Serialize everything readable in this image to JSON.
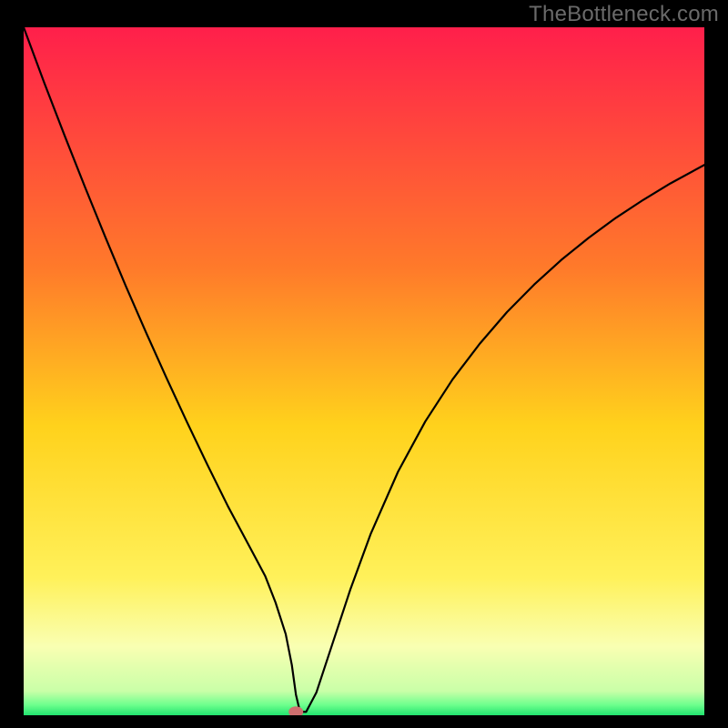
{
  "watermark": "TheBottleneck.com",
  "chart_data": {
    "type": "line",
    "title": "",
    "xlabel": "",
    "ylabel": "",
    "xlim": [
      0,
      100
    ],
    "ylim": [
      0,
      100
    ],
    "grid": false,
    "legend": false,
    "background_gradient_stops": [
      {
        "offset": 0.0,
        "color": "#ff1f4b"
      },
      {
        "offset": 0.35,
        "color": "#ff7a2a"
      },
      {
        "offset": 0.58,
        "color": "#ffd21c"
      },
      {
        "offset": 0.8,
        "color": "#fff15a"
      },
      {
        "offset": 0.9,
        "color": "#f9ffb2"
      },
      {
        "offset": 0.965,
        "color": "#c9ffa8"
      },
      {
        "offset": 0.985,
        "color": "#6dff8d"
      },
      {
        "offset": 1.0,
        "color": "#21e36e"
      }
    ],
    "marker": {
      "x": 40,
      "y": 0.5,
      "color": "#cf6f6f"
    },
    "series": [
      {
        "name": "curve",
        "color": "#000000",
        "width": 2.2,
        "x": [
          0,
          3,
          6,
          9,
          12,
          15,
          18,
          21,
          24,
          27,
          30,
          32,
          34,
          35.5,
          37,
          38.5,
          39.4,
          40,
          40.6,
          41.5,
          43,
          45,
          48,
          51,
          55,
          59,
          63,
          67,
          71,
          75,
          79,
          83,
          87,
          91,
          95,
          100
        ],
        "y": [
          100,
          92,
          84.3,
          76.8,
          69.5,
          62.4,
          55.6,
          49,
          42.6,
          36.4,
          30.4,
          26.7,
          23,
          20.2,
          16.4,
          11.8,
          7.3,
          3,
          0.5,
          0.5,
          3.3,
          9.3,
          18.3,
          26.4,
          35.4,
          42.7,
          48.8,
          54,
          58.6,
          62.6,
          66.2,
          69.4,
          72.3,
          74.9,
          77.3,
          80
        ]
      }
    ]
  }
}
